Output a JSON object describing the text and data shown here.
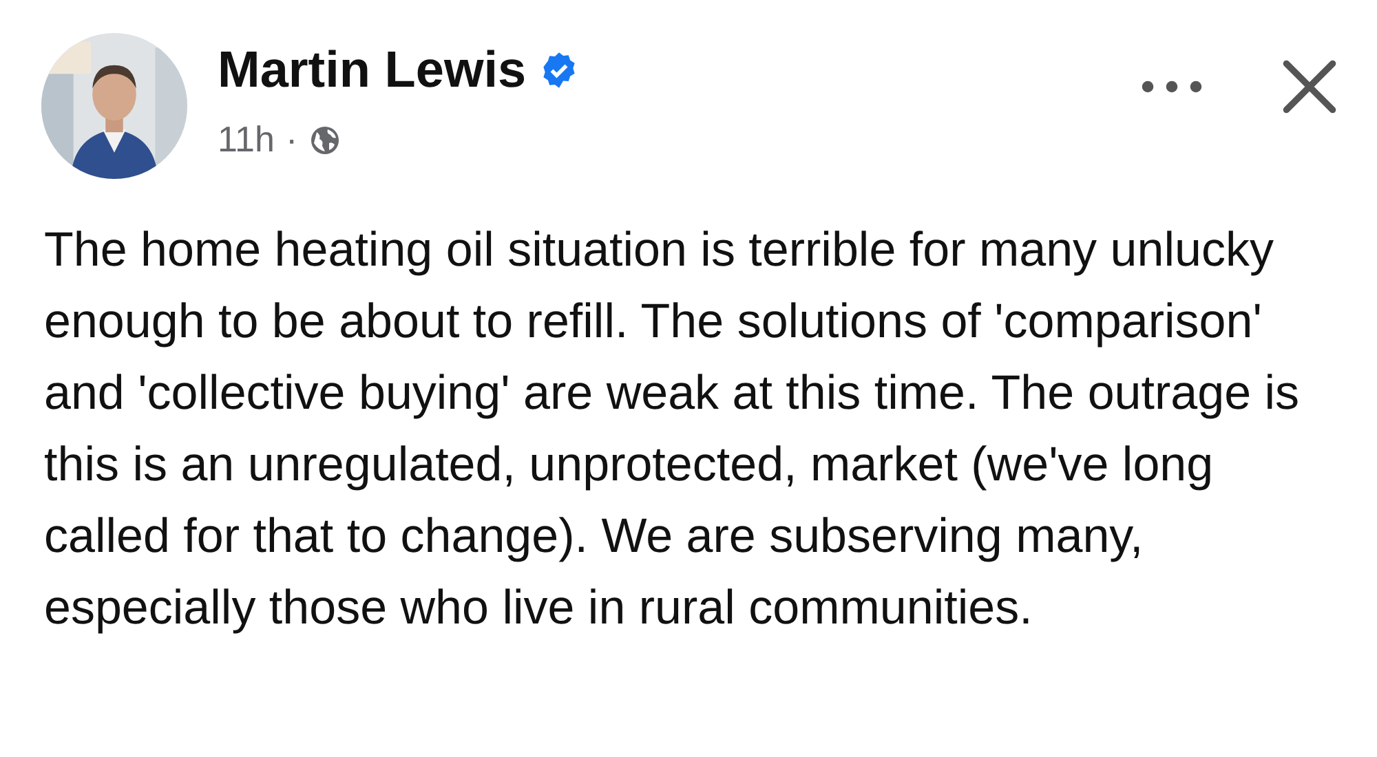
{
  "post": {
    "author": "Martin Lewis",
    "verified": true,
    "time": "11h",
    "separator": "·",
    "text": "The home heating oil situation is terrible for many unlucky enough to be about to refill. The solutions of 'comparison' and 'collective buying' are weak at this time. The outrage is this is an unregulated, unprotected, market (we've long called for that to change). We are subserving many, especially those who live in rural communities."
  }
}
